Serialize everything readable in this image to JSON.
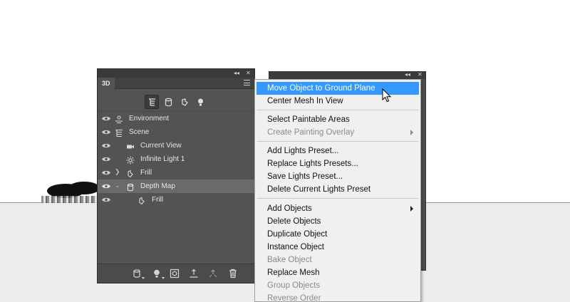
{
  "panel": {
    "tab_label": "3D",
    "collapse_glyph": "◂◂",
    "close_glyph": "✕",
    "filters": [
      {
        "icon": "scene-filter-icon",
        "active": true
      },
      {
        "icon": "mesh-filter-icon",
        "active": false
      },
      {
        "icon": "material-filter-icon",
        "active": false
      },
      {
        "icon": "light-filter-icon",
        "active": false
      }
    ],
    "tree": [
      {
        "label": "Environment",
        "icon": "environment-icon",
        "level": 0,
        "expander": "",
        "selected": false
      },
      {
        "label": "Scene",
        "icon": "scene-icon",
        "level": 0,
        "expander": "",
        "selected": false
      },
      {
        "label": "Current View",
        "icon": "camera-icon",
        "level": 1,
        "expander": "",
        "selected": false
      },
      {
        "label": "Infinite Light 1",
        "icon": "light-icon",
        "level": 1,
        "expander": "",
        "selected": false
      },
      {
        "label": "Frill",
        "icon": "mesh-icon",
        "level": 1,
        "expander": "closed",
        "selected": false
      },
      {
        "label": "Depth Map",
        "icon": "mesh-icon",
        "level": 1,
        "expander": "open",
        "selected": true
      },
      {
        "label": "Frill",
        "icon": "material-icon",
        "level": 2,
        "expander": "",
        "selected": false
      }
    ],
    "bottom_icons": [
      "mesh-add-icon",
      "light-add-icon",
      "render-icon",
      "ground-icon",
      "move-icon",
      "delete-icon"
    ]
  },
  "context_menu": {
    "groups": [
      [
        {
          "label": "Move Object to Ground Plane",
          "highlighted": true,
          "disabled": false,
          "submenu": false
        },
        {
          "label": "Center Mesh In View",
          "highlighted": false,
          "disabled": false,
          "submenu": false
        }
      ],
      [
        {
          "label": "Select Paintable Areas",
          "highlighted": false,
          "disabled": false,
          "submenu": false
        },
        {
          "label": "Create Painting Overlay",
          "highlighted": false,
          "disabled": true,
          "submenu": true
        }
      ],
      [
        {
          "label": "Add Lights Preset...",
          "highlighted": false,
          "disabled": false,
          "submenu": false
        },
        {
          "label": "Replace Lights Presets...",
          "highlighted": false,
          "disabled": false,
          "submenu": false
        },
        {
          "label": "Save Lights Preset...",
          "highlighted": false,
          "disabled": false,
          "submenu": false
        },
        {
          "label": "Delete Current Lights Preset",
          "highlighted": false,
          "disabled": false,
          "submenu": false
        }
      ],
      [
        {
          "label": "Add Objects",
          "highlighted": false,
          "disabled": false,
          "submenu": true
        },
        {
          "label": "Delete Objects",
          "highlighted": false,
          "disabled": false,
          "submenu": false
        },
        {
          "label": "Duplicate Object",
          "highlighted": false,
          "disabled": false,
          "submenu": false
        },
        {
          "label": "Instance Object",
          "highlighted": false,
          "disabled": false,
          "submenu": false
        },
        {
          "label": "Bake Object",
          "highlighted": false,
          "disabled": true,
          "submenu": false
        },
        {
          "label": "Replace Mesh",
          "highlighted": false,
          "disabled": false,
          "submenu": false
        },
        {
          "label": "Group Objects",
          "highlighted": false,
          "disabled": true,
          "submenu": false
        },
        {
          "label": "Reverse Order",
          "highlighted": false,
          "disabled": true,
          "submenu": false
        }
      ]
    ]
  },
  "colors": {
    "panel_bg": "#535353",
    "menu_highlight": "#3399ff",
    "menu_bg": "#f0f0f0"
  }
}
